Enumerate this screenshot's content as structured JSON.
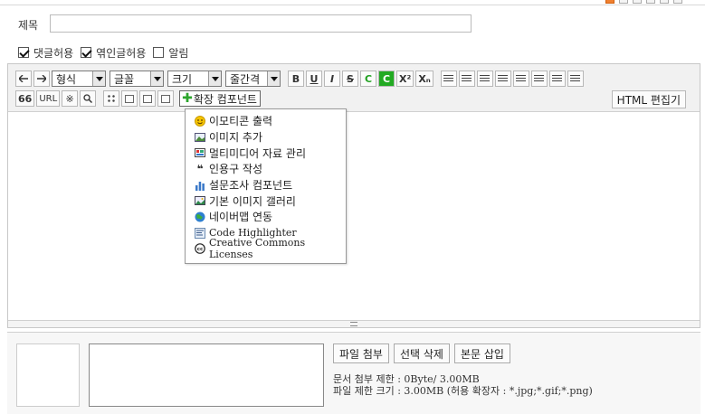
{
  "post": {
    "title_label": "제목",
    "title_value": ""
  },
  "options": [
    {
      "label": "댓글허용",
      "checked": true
    },
    {
      "label": "엮인글허용",
      "checked": true
    },
    {
      "label": "알림",
      "checked": false
    }
  ],
  "toolbar": {
    "undo_icon": "arrow-left",
    "redo_icon": "arrow-right",
    "format_select": "형식",
    "font_select": "글꼴",
    "size_select": "크기",
    "lineheight_select": "줄간격",
    "bold": "B",
    "underline": "U",
    "italic": "I",
    "strike": "S",
    "font_color": "C",
    "bg_color": "C",
    "superscript": "X²",
    "subscript": "Xₙ",
    "quote": "66",
    "url": "URL",
    "special_char": "※",
    "find": "Q",
    "extension_button": "확장 컴포넌트",
    "html_edit": "HTML 편집기"
  },
  "extension_menu": [
    {
      "label": "이모티콘 출력",
      "icon": "emoticon-icon"
    },
    {
      "label": "이미지 추가",
      "icon": "image-icon"
    },
    {
      "label": "멀티미디어 자료 관리",
      "icon": "multimedia-icon"
    },
    {
      "label": "인용구 작성",
      "icon": "quote-icon"
    },
    {
      "label": "설문조사 컴포넌트",
      "icon": "poll-chart-icon"
    },
    {
      "label": "기본 이미지 갤러리",
      "icon": "gallery-icon"
    },
    {
      "label": "네이버맵 연동",
      "icon": "globe-icon"
    },
    {
      "label": "Code Highlighter",
      "icon": "code-icon"
    },
    {
      "label": "Creative Commons Licenses",
      "icon": "cc-icon"
    }
  ],
  "attachment": {
    "attach_button": "파일 첨부",
    "delete_button": "선택 삭제",
    "insert_button": "본문 삽입",
    "limit_line": "문서 첨부 제한 : 0Byte/ 3.00MB",
    "size_line": "파일 제한 크기 : 3.00MB (허용 확장자 : *.jpg;*.gif;*.png)"
  },
  "colors": {
    "accent_green": "#22aa22",
    "toolbar_bg": "#f1f1f1"
  }
}
